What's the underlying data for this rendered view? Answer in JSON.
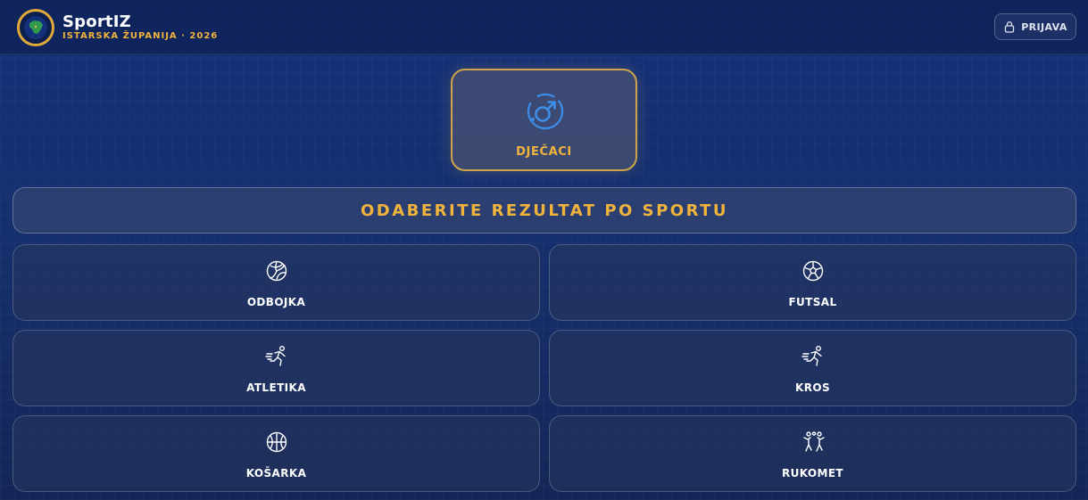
{
  "header": {
    "brand_name": "SportIZ",
    "brand_subtitle": "ISTARSKA ŽUPANIJA · 2026",
    "login_label": "PRIJAVA",
    "login_icon": "lock-icon",
    "logo_icon": "istria-map-icon"
  },
  "category": {
    "label": "DJEČACI",
    "icon": "male-symbol-icon"
  },
  "section": {
    "title": "ODABERITE REZULTAT PO SPORTU"
  },
  "sports": [
    {
      "label": "ODBOJKA",
      "icon": "volleyball-icon"
    },
    {
      "label": "FUTSAL",
      "icon": "soccer-ball-icon"
    },
    {
      "label": "ATLETIKA",
      "icon": "running-icon"
    },
    {
      "label": "KROS",
      "icon": "running-icon"
    },
    {
      "label": "KOŠARKA",
      "icon": "basketball-icon"
    },
    {
      "label": "RUKOMET",
      "icon": "handball-icon"
    }
  ],
  "colors": {
    "accent_gold": "#f0b43c",
    "card_border_gold": "#cfa44a",
    "background_navy": "#142a62",
    "male_icon_blue": "#3d8de8"
  }
}
